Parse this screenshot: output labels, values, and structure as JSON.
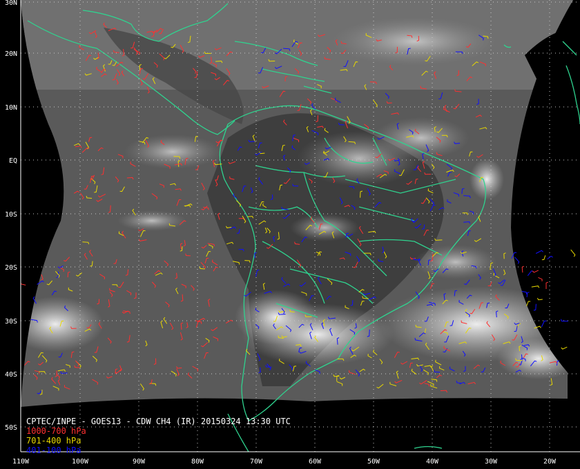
{
  "title": "CPTEC/INPE - GOES13 - CDW CH4 (IR) 20150324 13:30 UTC",
  "colors": {
    "background": "#000000",
    "coast": "#2fd38f",
    "grid": "#c8c8c8",
    "low": "#ff3030",
    "mid": "#e8d800",
    "high": "#1010ff"
  },
  "legend": [
    {
      "label": "1000-700 hPa",
      "color": "#ff3030"
    },
    {
      "label": "701-400 hPa",
      "color": "#e8d800"
    },
    {
      "label": "401-100 hPa",
      "color": "#1010ff"
    }
  ],
  "lat_labels": [
    "30N",
    "20N",
    "10N",
    "EQ",
    "10S",
    "20S",
    "30S",
    "40S",
    "50S"
  ],
  "lon_labels": [
    "110W",
    "100W",
    "90W",
    "80W",
    "70W",
    "60W",
    "50W",
    "40W",
    "30W",
    "20W"
  ]
}
